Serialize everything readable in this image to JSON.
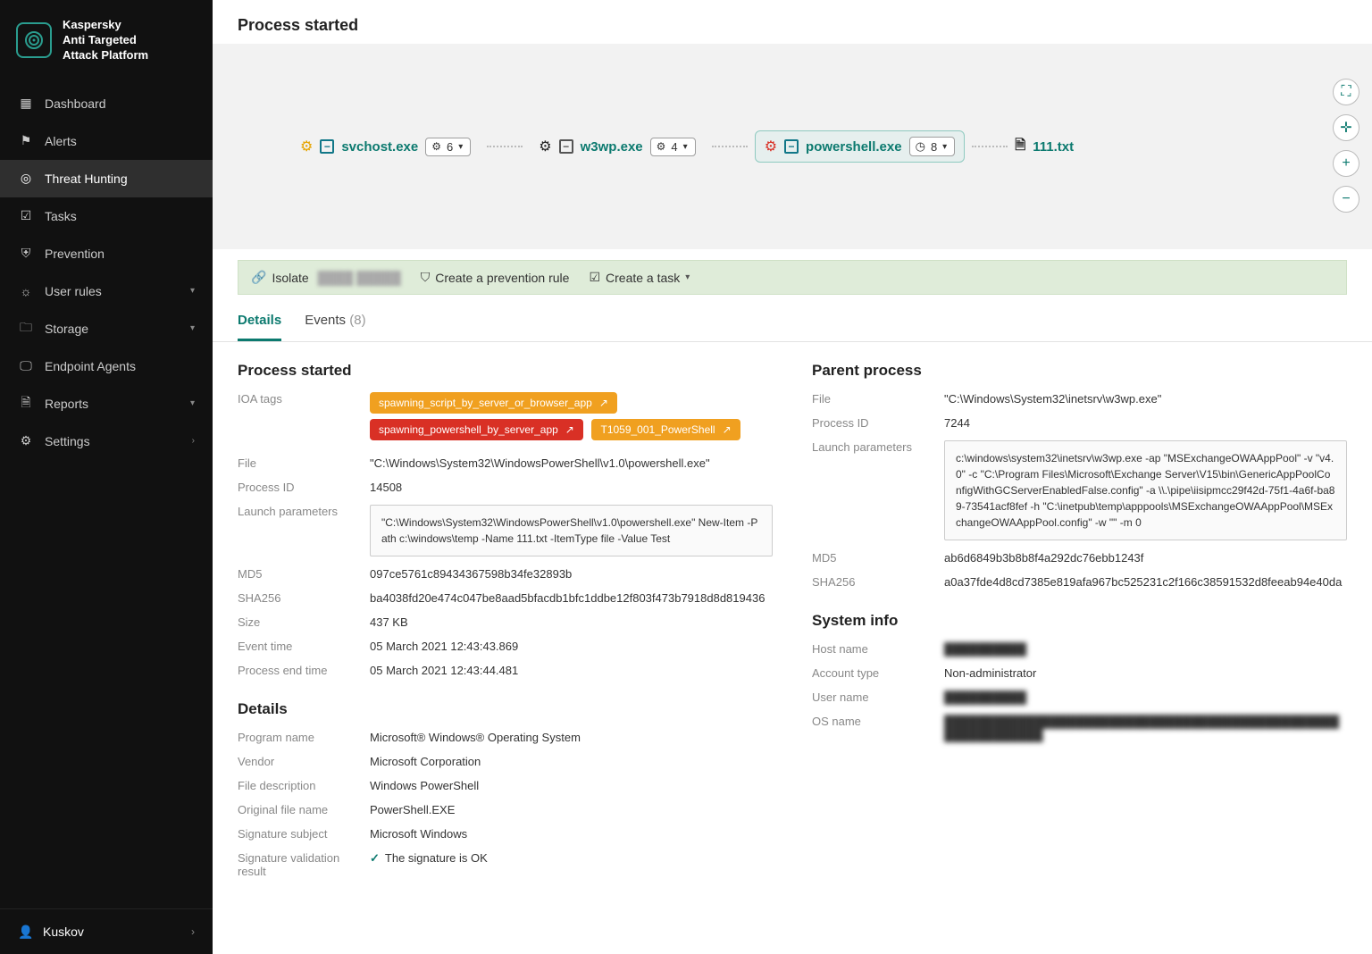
{
  "brand": "Kaspersky\nAnti Targeted\nAttack Platform",
  "sidebar": {
    "items": [
      {
        "label": "Dashboard"
      },
      {
        "label": "Alerts"
      },
      {
        "label": "Threat Hunting"
      },
      {
        "label": "Tasks"
      },
      {
        "label": "Prevention"
      },
      {
        "label": "User rules"
      },
      {
        "label": "Storage"
      },
      {
        "label": "Endpoint Agents"
      },
      {
        "label": "Reports"
      },
      {
        "label": "Settings"
      }
    ],
    "user": "Kuskov"
  },
  "page_title": "Process started",
  "chain": {
    "nodes": [
      {
        "name": "svchost.exe",
        "count": "6",
        "gear": "orange"
      },
      {
        "name": "w3wp.exe",
        "count": "4",
        "gear": "black"
      },
      {
        "name": "powershell.exe",
        "count": "8",
        "gear": "red",
        "selected": true,
        "clock": true
      },
      {
        "name": "111.txt",
        "type": "file"
      }
    ]
  },
  "actions": {
    "isolate": "Isolate",
    "prevention": "Create a prevention rule",
    "task": "Create a task"
  },
  "tabs": {
    "details": "Details",
    "events": "Events",
    "events_count": "(8)"
  },
  "process": {
    "heading": "Process started",
    "ioa_label": "IOA tags",
    "tags": [
      {
        "text": "spawning_script_by_server_or_browser_app",
        "cls": "orange"
      },
      {
        "text": "spawning_powershell_by_server_app",
        "cls": "red"
      },
      {
        "text": "T1059_001_PowerShell",
        "cls": "orange"
      }
    ],
    "file_label": "File",
    "file": "\"C:\\Windows\\System32\\WindowsPowerShell\\v1.0\\powershell.exe\"",
    "pid_label": "Process ID",
    "pid": "14508",
    "launch_label": "Launch parameters",
    "launch": "\"C:\\Windows\\System32\\WindowsPowerShell\\v1.0\\powershell.exe\" New-Item -Path c:\\windows\\temp -Name 111.txt -ItemType file -Value Test",
    "md5_label": "MD5",
    "md5": "097ce5761c89434367598b34fe32893b",
    "sha_label": "SHA256",
    "sha": "ba4038fd20e474c047be8aad5bfacdb1bfc1ddbe12f803f473b7918d8d819436",
    "size_label": "Size",
    "size": "437 KB",
    "etime_label": "Event time",
    "etime": "05 March 2021 12:43:43.869",
    "endtime_label": "Process end time",
    "endtime": "05 March 2021 12:43:44.481"
  },
  "details": {
    "heading": "Details",
    "progname_label": "Program name",
    "progname": "Microsoft® Windows® Operating System",
    "vendor_label": "Vendor",
    "vendor": "Microsoft Corporation",
    "filedesc_label": "File description",
    "filedesc": "Windows PowerShell",
    "origname_label": "Original file name",
    "origname": "PowerShell.EXE",
    "sigsubj_label": "Signature subject",
    "sigsubj": "Microsoft Windows",
    "sigvalid_label": "Signature validation result",
    "sigvalid": "The signature is OK"
  },
  "parent": {
    "heading": "Parent process",
    "file_label": "File",
    "file": "\"C:\\Windows\\System32\\inetsrv\\w3wp.exe\"",
    "pid_label": "Process ID",
    "pid": "7244",
    "launch_label": "Launch parameters",
    "launch": "c:\\windows\\system32\\inetsrv\\w3wp.exe -ap \"MSExchangeOWAAppPool\" -v \"v4.0\" -c \"C:\\Program Files\\Microsoft\\Exchange Server\\V15\\bin\\GenericAppPoolConfigWithGCServerEnabledFalse.config\" -a \\\\.\\pipe\\iisipmcc29f42d-75f1-4a6f-ba89-73541acf8fef -h \"C:\\inetpub\\temp\\apppools\\MSExchangeOWAAppPool\\MSExchangeOWAAppPool.config\" -w \"\" -m 0",
    "md5_label": "MD5",
    "md5": "ab6d6849b3b8b8f4a292dc76ebb1243f",
    "sha_label": "SHA256",
    "sha": "a0a37fde4d8cd7385e819afa967bc525231c2f166c38591532d8feeab94e40da"
  },
  "system": {
    "heading": "System info",
    "host_label": "Host name",
    "host": "██████████",
    "acct_label": "Account type",
    "acct": "Non-administrator",
    "user_label": "User name",
    "user": "██████████",
    "os_label": "OS name",
    "os": "████████████████████████████████████████████████████████████"
  }
}
